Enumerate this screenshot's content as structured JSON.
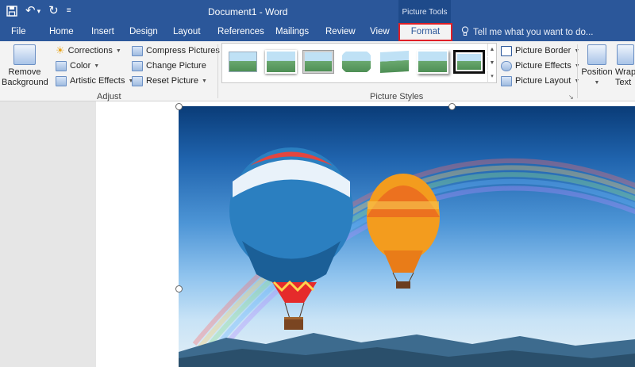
{
  "titlebar": {
    "save_icon": "save-icon",
    "undo_icon": "undo-icon",
    "redo_icon": "redo-icon",
    "customize_icon": "customize-qat-icon",
    "document_title": "Document1 - Word",
    "context_tools": "Picture Tools"
  },
  "tabs": [
    {
      "label": "File"
    },
    {
      "label": "Home"
    },
    {
      "label": "Insert"
    },
    {
      "label": "Design"
    },
    {
      "label": "Layout"
    },
    {
      "label": "References"
    },
    {
      "label": "Mailings"
    },
    {
      "label": "Review"
    },
    {
      "label": "View"
    },
    {
      "label": "Format",
      "active": true
    }
  ],
  "tell_me": {
    "icon": "lightbulb-icon",
    "placeholder": "Tell me what you want to do..."
  },
  "ribbon": {
    "adjust": {
      "remove_background_line1": "Remove",
      "remove_background_line2": "Background",
      "corrections": "Corrections",
      "color": "Color",
      "artistic_effects": "Artistic Effects",
      "compress_pictures": "Compress Pictures",
      "change_picture": "Change Picture",
      "reset_picture": "Reset Picture",
      "label": "Adjust"
    },
    "picture_styles": {
      "picture_border": "Picture Border",
      "picture_effects": "Picture Effects",
      "picture_layout": "Picture Layout",
      "label": "Picture Styles"
    },
    "arrange": {
      "position": "Position",
      "wrap_line1": "Wrap",
      "wrap_line2": "Text"
    }
  },
  "colors": {
    "titlebar": "#2b579a",
    "ribbon": "#f3f3f3",
    "highlight": "#e01f26"
  }
}
